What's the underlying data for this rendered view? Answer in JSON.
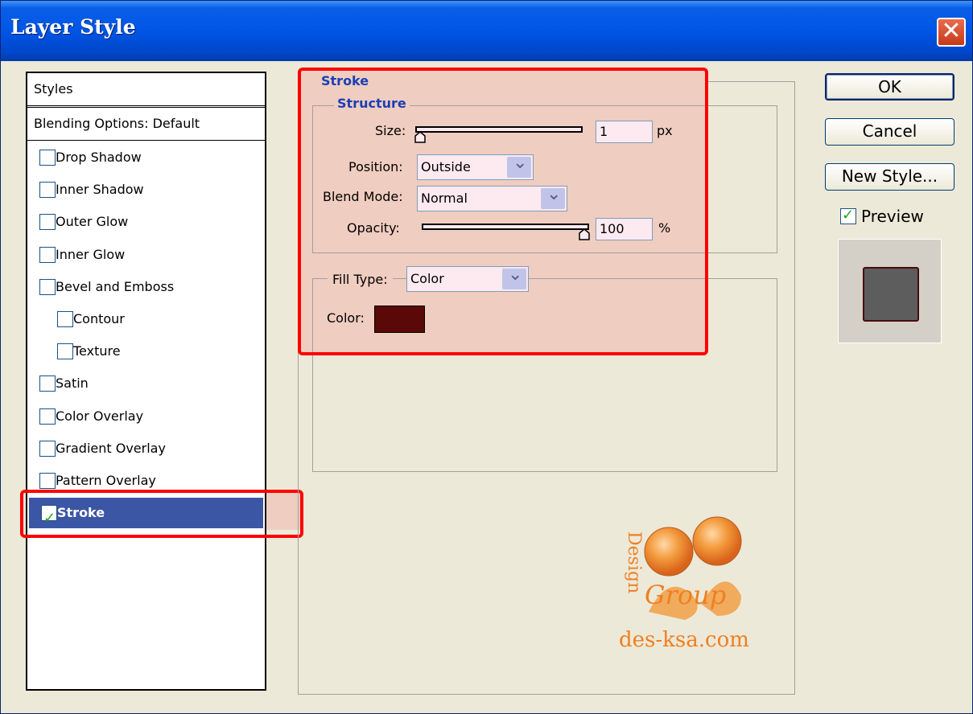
{
  "window": {
    "title": "Layer Style",
    "close_glyph": "✕"
  },
  "sidebar": {
    "header": "Styles",
    "blending_options": "Blending Options: Default",
    "items": [
      {
        "label": "Drop Shadow",
        "checked": false,
        "indent": 0
      },
      {
        "label": "Inner Shadow",
        "checked": false,
        "indent": 0
      },
      {
        "label": "Outer Glow",
        "checked": false,
        "indent": 0
      },
      {
        "label": "Inner Glow",
        "checked": false,
        "indent": 0
      },
      {
        "label": "Bevel and Emboss",
        "checked": false,
        "indent": 0
      },
      {
        "label": "Contour",
        "checked": false,
        "indent": 1
      },
      {
        "label": "Texture",
        "checked": false,
        "indent": 1
      },
      {
        "label": "Satin",
        "checked": false,
        "indent": 0
      },
      {
        "label": "Color Overlay",
        "checked": false,
        "indent": 0
      },
      {
        "label": "Gradient Overlay",
        "checked": false,
        "indent": 0
      },
      {
        "label": "Pattern Overlay",
        "checked": false,
        "indent": 0
      },
      {
        "label": "Stroke",
        "checked": true,
        "indent": 0,
        "selected": true
      }
    ]
  },
  "stroke": {
    "title": "Stroke",
    "structure": {
      "title": "Structure",
      "size_label": "Size:",
      "size_value": "1",
      "size_unit": "px",
      "size_slider_fraction": 0.0,
      "position_label": "Position:",
      "position_value": "Outside",
      "blend_mode_label": "Blend Mode:",
      "blend_mode_value": "Normal",
      "opacity_label": "Opacity:",
      "opacity_value": "100",
      "opacity_unit": "%",
      "opacity_slider_fraction": 1.0
    },
    "fill": {
      "fill_type_label": "Fill Type:",
      "fill_type_value": "Color",
      "color_label": "Color:",
      "color_value": "#5a0808"
    }
  },
  "buttons": {
    "ok": "OK",
    "cancel": "Cancel",
    "new_style": "New Style..."
  },
  "preview": {
    "label": "Preview",
    "checked": true
  },
  "watermark": {
    "text": "des-ksa.com",
    "logo_text": [
      "Design",
      "Group"
    ]
  },
  "colors": {
    "highlight": "#efcdc0",
    "annotation_red": "#ff0000",
    "selection": "#3c56a6",
    "legend_blue": "#1c3fb6"
  }
}
